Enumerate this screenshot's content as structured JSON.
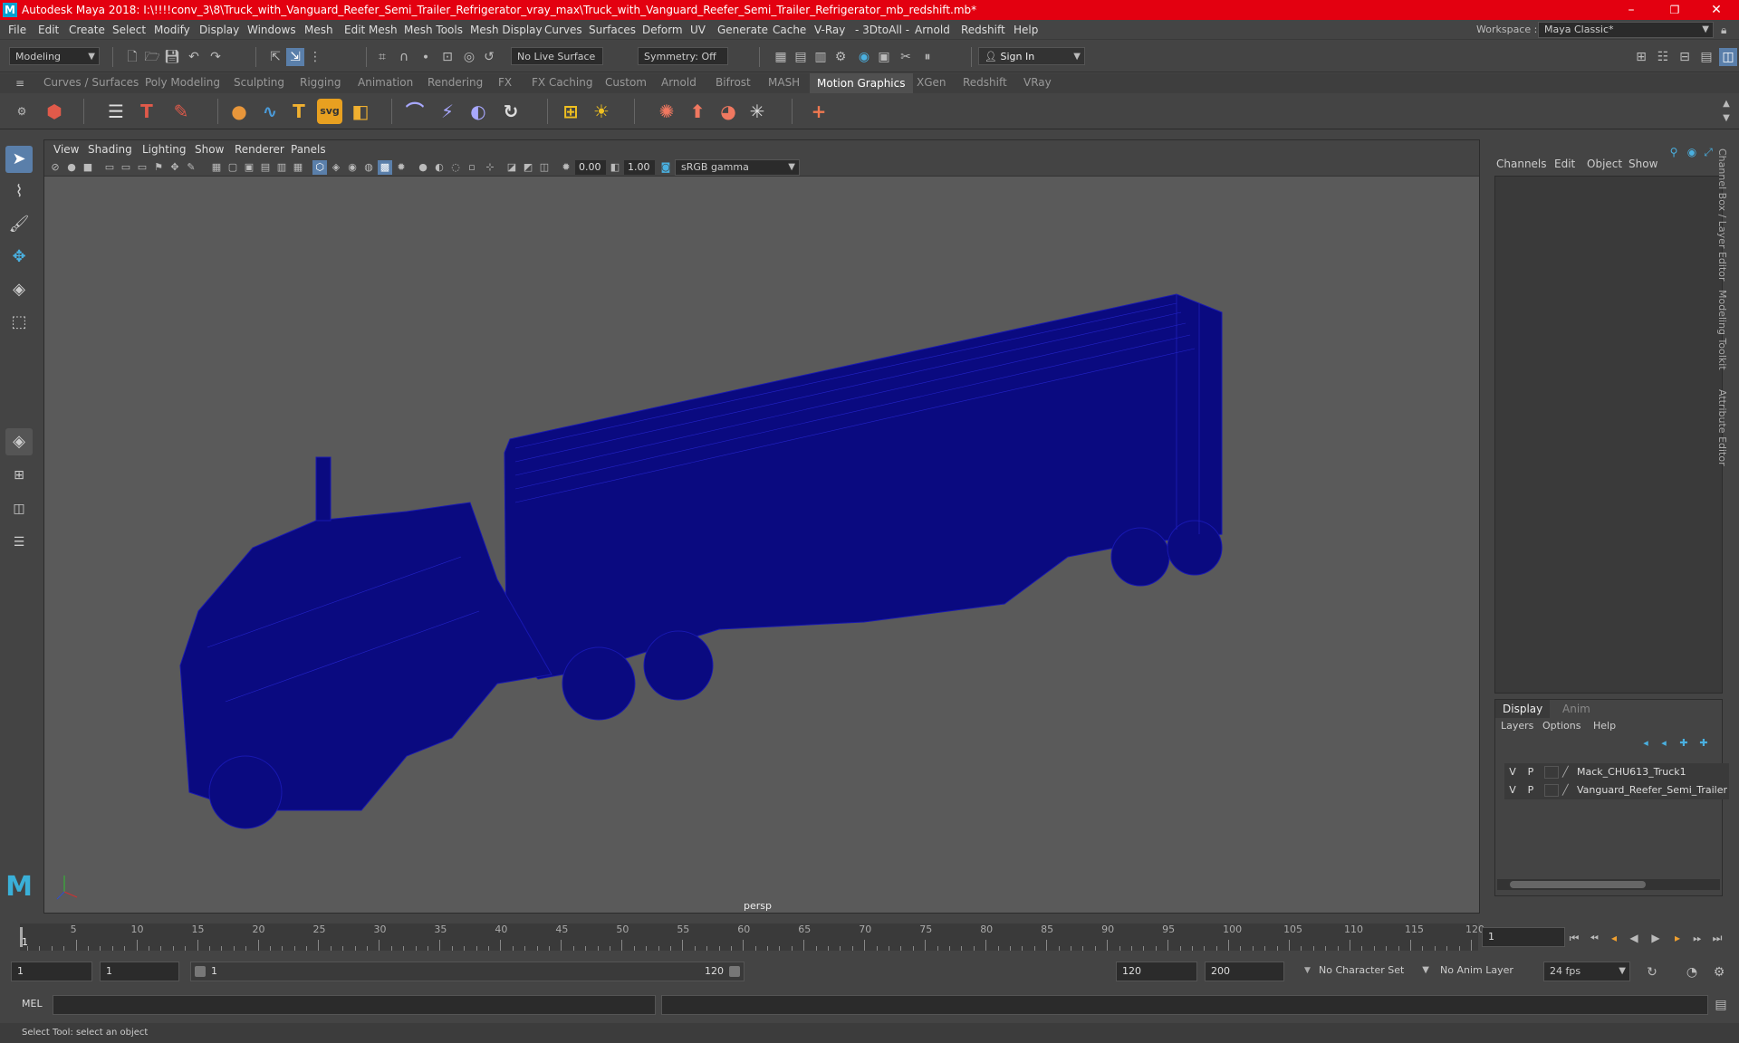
{
  "title": {
    "app_icon": "M",
    "text": "Autodesk Maya 2018: I:\\!!!!conv_3\\8\\Truck_with_Vanguard_Reefer_Semi_Trailer_Refrigerator_vray_max\\Truck_with_Vanguard_Reefer_Semi_Trailer_Refrigerator_mb_redshift.mb*",
    "minimize": "–",
    "maximize": "❐",
    "close": "✕"
  },
  "menu": {
    "items": [
      "File",
      "Edit",
      "Create",
      "Select",
      "Modify",
      "Display",
      "Windows",
      "Mesh",
      "Edit Mesh",
      "Mesh Tools",
      "Mesh Display",
      "Curves",
      "Surfaces",
      "Deform",
      "UV",
      "Generate",
      "Cache",
      "V-Ray",
      "- 3DtoAll -",
      "Arnold",
      "Redshift",
      "Help"
    ],
    "workspace_label": "Workspace :",
    "workspace_value": "Maya Classic*"
  },
  "status_line": {
    "menuset": "Modeling",
    "live_surface": "No Live Surface",
    "symmetry": "Symmetry: Off",
    "sign_in": "Sign In"
  },
  "shelf": {
    "tabs": [
      "Curves / Surfaces",
      "Poly Modeling",
      "Sculpting",
      "Rigging",
      "Animation",
      "Rendering",
      "FX",
      "FX Caching",
      "Custom",
      "Arnold",
      "Bifrost",
      "MASH",
      "Motion Graphics",
      "XGen",
      "Redshift",
      "VRay"
    ],
    "active_tab": "Motion Graphics",
    "icons": [
      {
        "name": "cube-icon",
        "glyph": "⬢",
        "color": "#e05a4a"
      },
      {
        "name": "list-icon",
        "glyph": "☰",
        "color": "#dddddd"
      },
      {
        "name": "type-red-icon",
        "glyph": "T",
        "color": "#e05a4a"
      },
      {
        "name": "brush-icon",
        "glyph": "✎",
        "color": "#e05a4a"
      },
      {
        "name": "sphere-icon",
        "glyph": "●",
        "color": "#e8963a"
      },
      {
        "name": "curve-icon",
        "glyph": "∿",
        "color": "#4a9ad8"
      },
      {
        "name": "type-icon",
        "glyph": "T",
        "color": "#f0b030"
      },
      {
        "name": "svg-icon",
        "glyph": "svg",
        "color": "#f0b030"
      },
      {
        "name": "box-icon",
        "glyph": "◧",
        "color": "#f0b030"
      },
      {
        "name": "bend-icon",
        "glyph": "⌒",
        "color": "#a8a8ff"
      },
      {
        "name": "twist-icon",
        "glyph": "⚡",
        "color": "#a8a8ff"
      },
      {
        "name": "flare-icon",
        "glyph": "◐",
        "color": "#a8a8ff"
      },
      {
        "name": "wave-icon",
        "glyph": "↻",
        "color": "#dddddd"
      },
      {
        "name": "instance-icon",
        "glyph": "⊞",
        "color": "#f0c020"
      },
      {
        "name": "sun-icon",
        "glyph": "☀",
        "color": "#f0c020"
      },
      {
        "name": "emitter-icon",
        "glyph": "✺",
        "color": "#f07860"
      },
      {
        "name": "shatter-icon",
        "glyph": "⬆",
        "color": "#f07860"
      },
      {
        "name": "dynamics-icon",
        "glyph": "◕",
        "color": "#f07860"
      },
      {
        "name": "fracture-icon",
        "glyph": "✳",
        "color": "#dddddd"
      },
      {
        "name": "locator-icon",
        "glyph": "+",
        "color": "#f07850"
      }
    ]
  },
  "viewport": {
    "menus": [
      "View",
      "Shading",
      "Lighting",
      "Show",
      "Renderer",
      "Panels"
    ],
    "exposure": "0.00",
    "gamma": "1.00",
    "color_space": "sRGB gamma",
    "camera_label": "persp"
  },
  "channel_box": {
    "menus": [
      "Channels",
      "Edit",
      "Object",
      "Show"
    ],
    "side_tabs": [
      "Channel Box / Layer Editor",
      "Modeling Toolkit",
      "Attribute Editor"
    ]
  },
  "layer_editor": {
    "tabs": [
      "Display",
      "Anim"
    ],
    "active_tab": "Display",
    "menus": [
      "Layers",
      "Options",
      "Help"
    ],
    "layers": [
      {
        "v": "V",
        "p": "P",
        "name": "Mack_CHU613_Truck1"
      },
      {
        "v": "V",
        "p": "P",
        "name": "Vanguard_Reefer_Semi_Trailer"
      }
    ]
  },
  "timeline": {
    "labels": [
      "5",
      "10",
      "15",
      "20",
      "25",
      "30",
      "35",
      "40",
      "45",
      "50",
      "55",
      "60",
      "65",
      "70",
      "75",
      "80",
      "85",
      "90",
      "95",
      "100",
      "105",
      "110",
      "115",
      "120"
    ],
    "current_frame_marker": "1",
    "current_frame": "1"
  },
  "range": {
    "start": "1",
    "playback_start": "1",
    "slider_start": "1",
    "slider_end": "120",
    "playback_end": "120",
    "end": "200",
    "character_set": "No Character Set",
    "anim_layer": "No Anim Layer",
    "fps": "24 fps"
  },
  "command_line": {
    "label": "MEL"
  },
  "help_line": "Select Tool: select an object",
  "colors": {
    "title_bar": "#e30010",
    "wireframe": "#0a0a80",
    "accent": "#5a9ad0"
  }
}
